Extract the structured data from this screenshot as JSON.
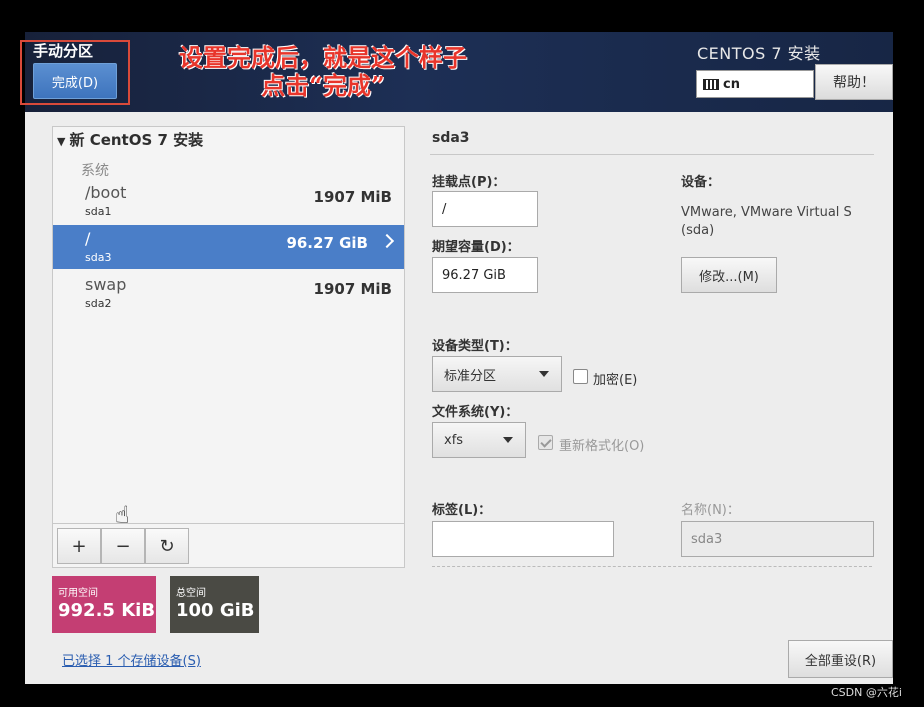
{
  "header": {
    "title": "手动分区",
    "done_label": "完成(D)",
    "annotation_line1": "设置完成后，就是这个样子",
    "annotation_line2": "点击“完成”",
    "product": "CENTOS 7 安装",
    "keyboard_layout": "cn",
    "help_label": "帮助！"
  },
  "partitions": {
    "tree_title": "新 CentOS 7 安装",
    "section_label": "系统",
    "items": [
      {
        "mount": "/boot",
        "device": "sda1",
        "size": "1907 MiB",
        "selected": false
      },
      {
        "mount": "/",
        "device": "sda3",
        "size": "96.27 GiB",
        "selected": true
      },
      {
        "mount": "swap",
        "device": "sda2",
        "size": "1907 MiB",
        "selected": false
      }
    ],
    "toolbar": {
      "add": "+",
      "remove": "−",
      "refresh": "↻"
    }
  },
  "space": {
    "available_label": "可用空间",
    "available_value": "992.5 KiB",
    "total_label": "总空间",
    "total_value": "100 GiB",
    "available_color": "#c43e73",
    "total_color": "#4a4a44"
  },
  "storage_link": "已选择 1 个存储设备(S)",
  "details": {
    "title": "sda3",
    "mount_label": "挂载点(P)：",
    "mount_value": "/",
    "capacity_label": "期望容量(D)：",
    "capacity_value": "96.27 GiB",
    "device_label": "设备：",
    "device_text": "VMware, VMware Virtual S (sda)",
    "modify_label": "修改...(M)",
    "device_type_label": "设备类型(T)：",
    "device_type_value": "标准分区",
    "encrypt_label": "加密(E)",
    "filesystem_label": "文件系统(Y)：",
    "filesystem_value": "xfs",
    "reformat_label": "重新格式化(O)",
    "tag_label": "标签(L)：",
    "tag_value": "",
    "name_label": "名称(N)：",
    "name_value": "sda3"
  },
  "reset_label": "全部重设(R)",
  "watermark": "CSDN @六花i",
  "colors": {
    "accent": "#4a7ec8",
    "annotation": "#e8352b"
  }
}
